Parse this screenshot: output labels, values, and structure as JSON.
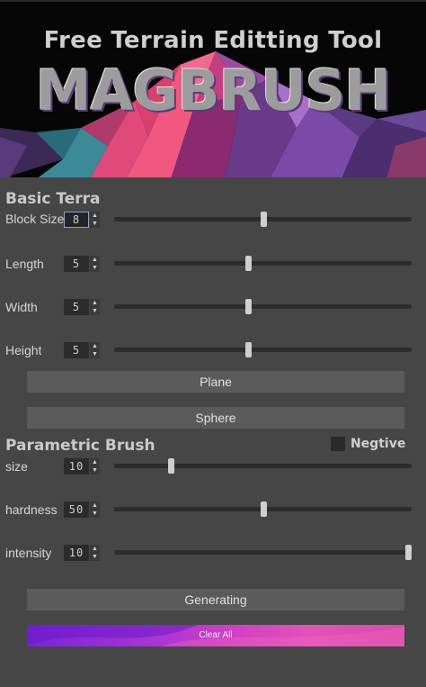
{
  "banner": {
    "subtitle": "Free Terrain Editting Tool",
    "brand": "MAGBRUSH"
  },
  "basic": {
    "title": "Basic Terrain",
    "rows": [
      {
        "label": "Block Size",
        "value": "8",
        "fraction": 0.5
      },
      {
        "label": "Length",
        "value": "5",
        "fraction": 0.45
      },
      {
        "label": "Width",
        "value": "5",
        "fraction": 0.45
      },
      {
        "label": "Height",
        "value": "5",
        "fraction": 0.45
      }
    ],
    "buttons": [
      "Plane",
      "Sphere"
    ]
  },
  "parametric": {
    "title": "Parametric Brush",
    "negative_label": "Negtive",
    "negative_checked": false,
    "rows": [
      {
        "label": "size",
        "value": "10",
        "fraction": 0.19
      },
      {
        "label": "hardness",
        "value": "50",
        "fraction": 0.5
      },
      {
        "label": "intensity",
        "value": "10",
        "fraction": 1.0
      }
    ],
    "generate_label": "Generating",
    "clear_label": "Clear All"
  },
  "colors": {
    "panel": "#464646",
    "button": "#5b5b5b",
    "accent_start": "#7a22d8",
    "accent_end": "#e451b8"
  }
}
